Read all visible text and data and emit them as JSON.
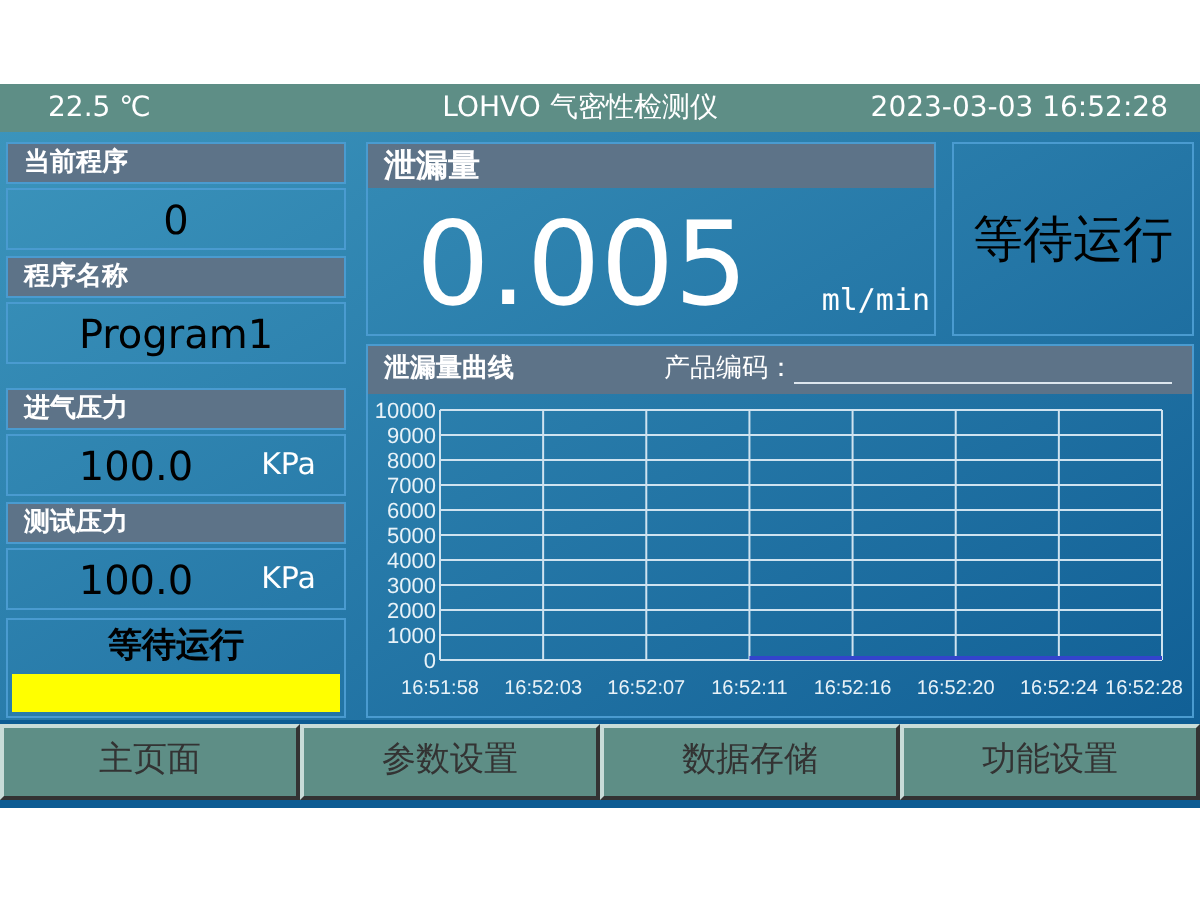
{
  "header": {
    "temperature": "22.5 ℃",
    "title": "LOHVO 气密性检测仪",
    "datetime": "2023-03-03 16:52:28"
  },
  "left_panels": [
    {
      "label": "当前程序",
      "value": "0"
    },
    {
      "label": "程序名称",
      "value": "Program1"
    },
    {
      "label": "进气压力",
      "value": "100.0",
      "unit": "KPa"
    },
    {
      "label": "测试压力",
      "value": "100.0",
      "unit": "KPa"
    }
  ],
  "status": {
    "text": "等待运行"
  },
  "leak": {
    "label": "泄漏量",
    "value": "0.005",
    "unit": "ml/min"
  },
  "run_state": "等待运行",
  "chart_panel": {
    "title": "泄漏量曲线",
    "product_code_label": "产品编码：",
    "chart_data": {
      "type": "line",
      "categories": [
        "16:51:58",
        "16:52:03",
        "16:52:07",
        "16:52:11",
        "16:52:16",
        "16:52:20",
        "16:52:24",
        "16:52:28"
      ],
      "series": [
        {
          "color": "#3344cc",
          "values": [
            null,
            null,
            null,
            0,
            0,
            0,
            0,
            0
          ]
        }
      ],
      "grid": true,
      "ylim": [
        0,
        10000
      ],
      "yticks": [
        0,
        1000,
        2000,
        3000,
        4000,
        5000,
        6000,
        7000,
        8000,
        9000,
        10000
      ]
    }
  },
  "nav": [
    {
      "label": "主页面"
    },
    {
      "label": "参数设置"
    },
    {
      "label": "数据存储"
    },
    {
      "label": "功能设置"
    }
  ]
}
